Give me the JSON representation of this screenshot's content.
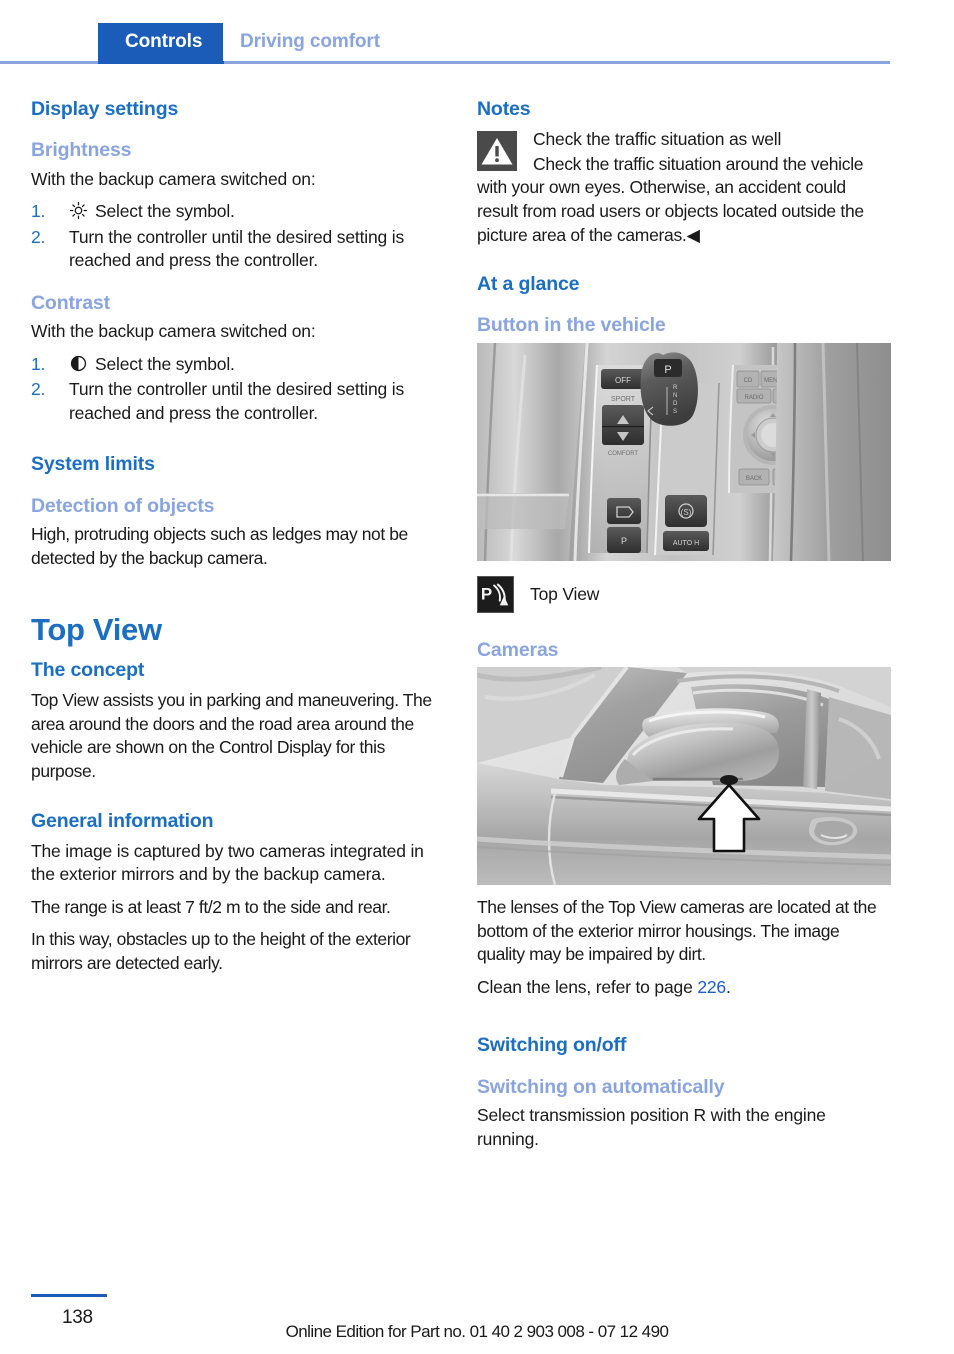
{
  "header": {
    "tab_label": "Controls",
    "subtitle": "Driving comfort"
  },
  "left_column": {
    "display_settings": {
      "heading": "Display settings",
      "brightness": {
        "heading": "Brightness",
        "intro": "With the backup camera switched on:",
        "steps": [
          {
            "num": "1.",
            "icon": "brightness-sun-icon",
            "text": "Select the symbol."
          },
          {
            "num": "2.",
            "icon": null,
            "text": "Turn the controller until the desired setting is reached and press the controller."
          }
        ]
      },
      "contrast": {
        "heading": "Contrast",
        "intro": "With the backup camera switched on:",
        "steps": [
          {
            "num": "1.",
            "icon": "contrast-half-circle-icon",
            "text": "Select the symbol."
          },
          {
            "num": "2.",
            "icon": null,
            "text": "Turn the controller until the desired setting is reached and press the controller."
          }
        ]
      }
    },
    "system_limits": {
      "heading": "System limits",
      "detection": {
        "heading": "Detection of objects",
        "text": "High, protruding objects such as ledges may not be detected by the backup camera."
      }
    },
    "top_view": {
      "chapter_title": "Top View",
      "concept": {
        "heading": "The concept",
        "text": "Top View assists you in parking and maneuvering. The area around the doors and the road area around the vehicle are shown on the Control Display for this purpose."
      },
      "general_information": {
        "heading": "General information",
        "paragraphs": [
          "The image is captured by two cameras integrated in the exterior mirrors and by the backup camera.",
          "The range is at least 7 ft/2 m to the side and rear.",
          "In this way, obstacles up to the height of the exterior mirrors are detected early."
        ]
      }
    }
  },
  "right_column": {
    "notes": {
      "heading": "Notes",
      "warning_icon": "warning-triangle-icon",
      "warning_title": "Check the traffic situation as well",
      "warning_body": "Check the traffic situation around the vehicle with your own eyes. Otherwise, an accident could result from road users or objects located outside the picture area of the cameras.",
      "end_mark": "◀"
    },
    "at_a_glance": {
      "heading": "At a glance",
      "button_in_vehicle": {
        "heading": "Button in the vehicle",
        "figure_name": "center-console-photo",
        "caption_icon": "top-view-button-icon",
        "caption_label": "Top View"
      },
      "cameras": {
        "heading": "Cameras",
        "figure_name": "exterior-mirror-camera-photo",
        "paragraphs": [
          "The lenses of the Top View cameras are located at the bottom of the exterior mirror housings. The image quality may be impaired by dirt."
        ],
        "clean_prefix": "Clean the lens, refer to page ",
        "clean_page_ref": "226",
        "clean_suffix": "."
      }
    },
    "switching": {
      "heading": "Switching on/off",
      "automatically": {
        "heading": "Switching on automatically",
        "text": "Select transmission position R with the engine running."
      }
    }
  },
  "footer": {
    "page_number": "138",
    "note": "Online Edition for Part no. 01 40 2 903 008 - 07 12 490"
  }
}
